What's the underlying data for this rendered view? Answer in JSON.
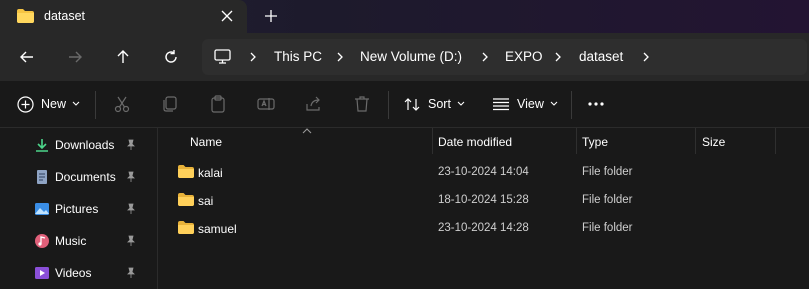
{
  "tab": {
    "title": "dataset"
  },
  "address": {
    "crumbs": [
      "This PC",
      "New Volume (D:)",
      "EXPO",
      "dataset"
    ]
  },
  "toolbar": {
    "new_label": "New",
    "sort_label": "Sort",
    "view_label": "View"
  },
  "sidebar": {
    "items": [
      {
        "label": "Downloads",
        "icon": "download-icon"
      },
      {
        "label": "Documents",
        "icon": "documents-icon"
      },
      {
        "label": "Pictures",
        "icon": "pictures-icon"
      },
      {
        "label": "Music",
        "icon": "music-icon"
      },
      {
        "label": "Videos",
        "icon": "videos-icon"
      }
    ]
  },
  "columns": {
    "name": "Name",
    "date": "Date modified",
    "type": "Type",
    "size": "Size"
  },
  "files": [
    {
      "name": "kalai",
      "date": "23-10-2024 14:04",
      "type": "File folder"
    },
    {
      "name": "sai",
      "date": "18-10-2024 15:28",
      "type": "File folder"
    },
    {
      "name": "samuel",
      "date": "23-10-2024 14:28",
      "type": "File folder"
    }
  ],
  "colors": {
    "folder": "#f5c443",
    "accent": "#4cc2ff",
    "background": "#191919"
  }
}
